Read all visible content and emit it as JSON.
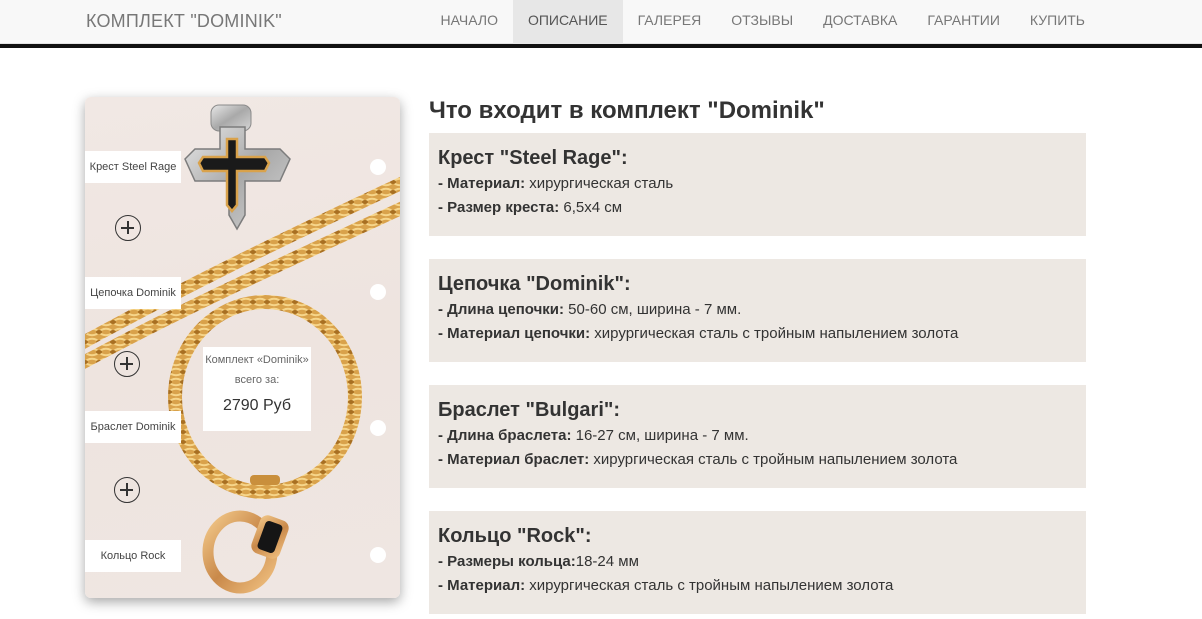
{
  "brand": "КОМПЛЕКТ \"DOMINIK\"",
  "nav": [
    {
      "label": "НАЧАЛО",
      "active": false
    },
    {
      "label": "ОПИСАНИЕ",
      "active": true
    },
    {
      "label": "ГАЛЕРЕЯ",
      "active": false
    },
    {
      "label": "ОТЗЫВЫ",
      "active": false
    },
    {
      "label": "ДОСТАВКА",
      "active": false
    },
    {
      "label": "ГАРАНТИИ",
      "active": false
    },
    {
      "label": "КУПИТЬ",
      "active": false
    }
  ],
  "image": {
    "labels": [
      "Крест Steel Rage",
      "Цепочка Dominik",
      "Браслет Dominik",
      "Кольцо Rock"
    ],
    "price_caption_1": "Комплект «Dominik»",
    "price_caption_2": "всего за:",
    "price_value": "2790 Руб"
  },
  "section_title": "Что входит в комплект \"Dominik\"",
  "cards": [
    {
      "title": "Крест \"Steel Rage\":",
      "lines": [
        {
          "key": "- Материал:",
          "value": " хирургическая сталь"
        },
        {
          "key": "- Размер креста:",
          "value": " 6,5х4 см"
        }
      ]
    },
    {
      "title": "Цепочка \"Dominik\":",
      "lines": [
        {
          "key": "- Длина цепочки:",
          "value": " 50-60 см, ширина - 7 мм."
        },
        {
          "key": "- Материал цепочки:",
          "value": " хирургическая сталь с тройным напылением золота"
        }
      ]
    },
    {
      "title": "Браслет \"Bulgari\":",
      "lines": [
        {
          "key": "- Длина браслета:",
          "value": " 16-27 см, ширина - 7 мм."
        },
        {
          "key": "- Материал браслет:",
          "value": " хирургическая сталь с тройным напылением золота"
        }
      ]
    },
    {
      "title": "Кольцо \"Rock\":",
      "lines": [
        {
          "key": "- Размеры кольца:",
          "value": "18-24 мм"
        },
        {
          "key": "- Материал:",
          "value": " хирургическая сталь с тройным напылением золота"
        }
      ]
    }
  ],
  "colors": {
    "navbar_bg": "#f8f8f8",
    "nav_active_bg": "#e7e7e7",
    "card_bg": "#ede8e3",
    "gold": "#d9a24b"
  }
}
